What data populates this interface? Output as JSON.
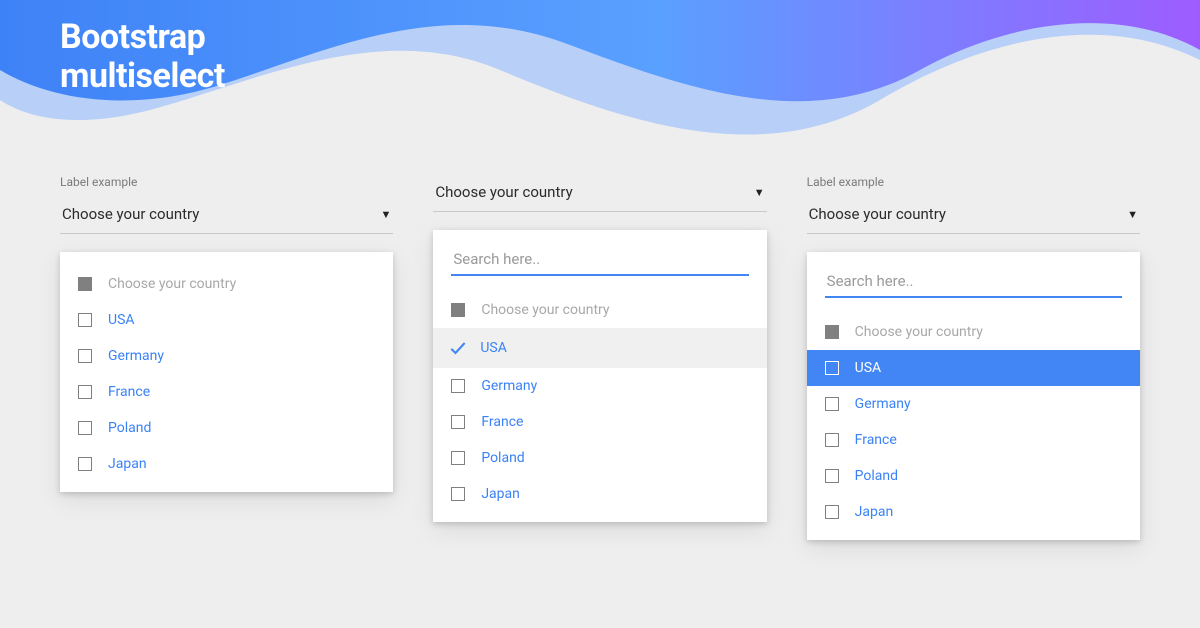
{
  "hero": {
    "title_line1": "Bootstrap",
    "title_line2": "multiselect"
  },
  "common": {
    "label": "Label example",
    "header_text": "Choose your country",
    "placeholder_opt": "Choose your country",
    "search_placeholder": "Search here..",
    "options": [
      "USA",
      "Germany",
      "France",
      "Poland",
      "Japan"
    ]
  }
}
